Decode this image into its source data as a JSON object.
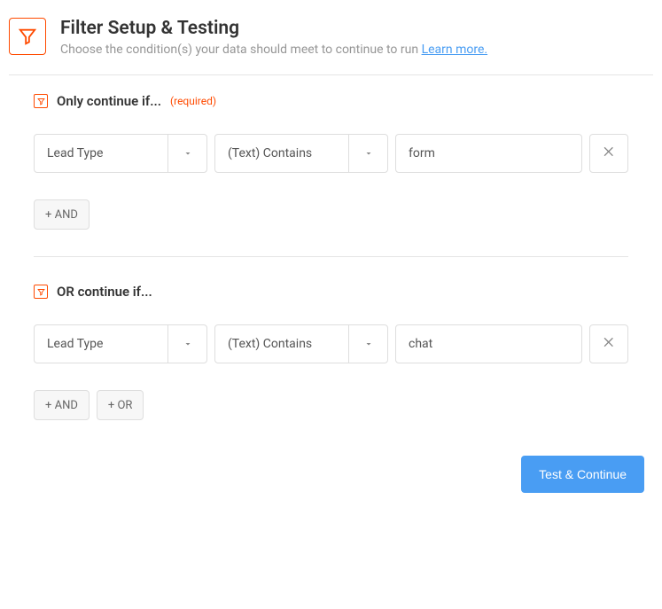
{
  "header": {
    "title": "Filter Setup & Testing",
    "subtitle": "Choose the condition(s) your data should meet to continue to run ",
    "learn_more": "Learn more."
  },
  "groups": [
    {
      "label": "Only continue if...",
      "required_text": "(required)",
      "show_required": true,
      "conditions": [
        {
          "field": "Lead Type",
          "operator": "(Text) Contains",
          "value": "form"
        }
      ],
      "show_and": true,
      "show_or": false
    },
    {
      "label": "OR continue if...",
      "required_text": "",
      "show_required": false,
      "conditions": [
        {
          "field": "Lead Type",
          "operator": "(Text) Contains",
          "value": "chat"
        }
      ],
      "show_and": true,
      "show_or": true
    }
  ],
  "buttons": {
    "and": "+ AND",
    "or": "+ OR",
    "test_continue": "Test & Continue"
  },
  "colors": {
    "accent": "#ff4a00",
    "primary": "#499df3"
  }
}
